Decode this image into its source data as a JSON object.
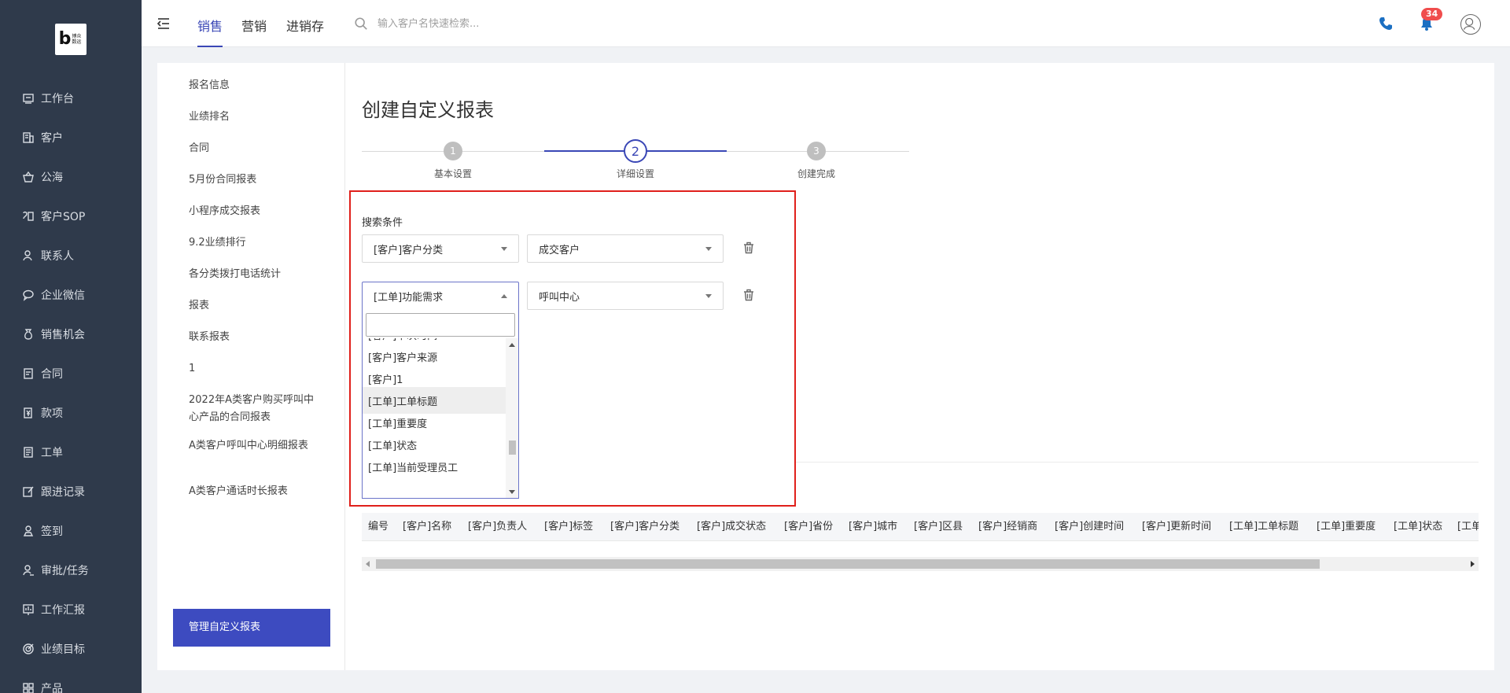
{
  "nav": {
    "logo_mark": "b",
    "logo_text": "博众数运",
    "items": [
      {
        "label": "工作台",
        "icon": "dashboard-icon"
      },
      {
        "label": "客户",
        "icon": "building-icon"
      },
      {
        "label": "公海",
        "icon": "basket-icon"
      },
      {
        "label": "客户SOP",
        "icon": "sop-icon"
      },
      {
        "label": "联系人",
        "icon": "person-icon"
      },
      {
        "label": "企业微信",
        "icon": "chat-icon"
      },
      {
        "label": "销售机会",
        "icon": "money-bag-icon"
      },
      {
        "label": "合同",
        "icon": "contract-icon"
      },
      {
        "label": "款项",
        "icon": "payment-icon"
      },
      {
        "label": "工单",
        "icon": "ticket-icon"
      },
      {
        "label": "跟进记录",
        "icon": "edit-icon"
      },
      {
        "label": "签到",
        "icon": "checkin-icon"
      },
      {
        "label": "审批/任务",
        "icon": "approval-icon"
      },
      {
        "label": "工作汇报",
        "icon": "report-icon"
      },
      {
        "label": "业绩目标",
        "icon": "target-icon"
      },
      {
        "label": "产品",
        "icon": "product-icon"
      }
    ]
  },
  "header": {
    "tabs": [
      "销售",
      "营销",
      "进销存"
    ],
    "active_tab": "销售",
    "search_placeholder": "输入客户名快速检索...",
    "notification_count": "34",
    "accent_color": "#3a47b6",
    "badge_color": "#f04d4d"
  },
  "sub_nav": {
    "items": [
      "报名信息",
      "业绩排名",
      "合同",
      "5月份合同报表",
      "小程序成交报表",
      "9.2业绩排行",
      "各分类拨打电话统计",
      "报表",
      "联系报表",
      "1",
      "2022年A类客户购买呼叫中心产品的合同报表",
      "A类客户呼叫中心明细报表",
      "A类客户通话时长报表"
    ],
    "active_item": "管理自定义报表"
  },
  "page": {
    "title": "创建自定义报表",
    "steps": [
      {
        "num": "1",
        "label": "基本设置"
      },
      {
        "num": "2",
        "label": "详细设置"
      },
      {
        "num": "3",
        "label": "创建完成"
      }
    ],
    "active_step": 2,
    "search_conditions_label": "搜索条件",
    "conditions": [
      {
        "field": "[客户]客户分类",
        "value": "成交客户"
      },
      {
        "field": "[工单]功能需求",
        "value": "呼叫中心"
      }
    ],
    "dropdown": {
      "search_value": "",
      "items": [
        "[客户]下次时间",
        "[客户]客户来源",
        "[客户]1",
        "[工单]工单标题",
        "[工单]重要度",
        "[工单]状态",
        "[工单]当前受理员工"
      ],
      "hovered_item": "[工单]工单标题"
    },
    "table_columns": [
      "编号",
      "[客户]名称",
      "[客户]负责人",
      "[客户]标签",
      "[客户]客户分类",
      "[客户]成交状态",
      "[客户]省份",
      "[客户]城市",
      "[客户]区县",
      "[客户]经销商",
      "[客户]创建时间",
      "[客户]更新时间",
      "[工单]工单标题",
      "[工单]重要度",
      "[工单]状态",
      "[工单]"
    ],
    "highlight_color": "#e0201b"
  }
}
